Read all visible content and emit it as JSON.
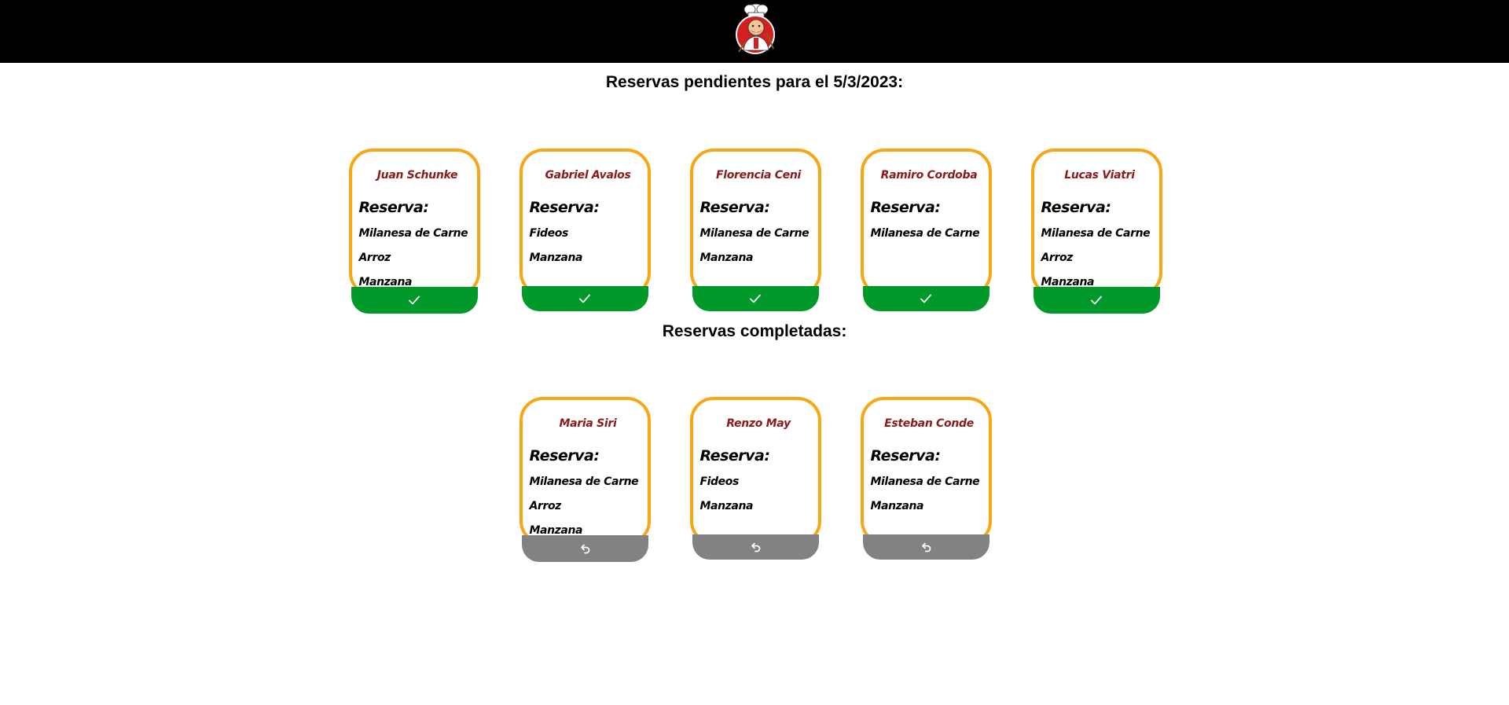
{
  "header": {
    "logo_icon": "chef-logo"
  },
  "pending": {
    "title": "Reservas pendientes para el 5/3/2023:",
    "button_icon": "check-icon",
    "cards": [
      {
        "name": "Juan Schunke",
        "heading": "Reserva:",
        "items": [
          "Milanesa de Carne",
          "Arroz",
          "Manzana"
        ]
      },
      {
        "name": "Gabriel Avalos",
        "heading": "Reserva:",
        "items": [
          "Fideos",
          "Manzana"
        ]
      },
      {
        "name": "Florencia Ceni",
        "heading": "Reserva:",
        "items": [
          "Milanesa de Carne",
          "Manzana"
        ]
      },
      {
        "name": "Ramiro Cordoba",
        "heading": "Reserva:",
        "items": [
          "Milanesa de Carne"
        ]
      },
      {
        "name": "Lucas Viatri",
        "heading": "Reserva:",
        "items": [
          "Milanesa de Carne",
          "Arroz",
          "Manzana"
        ]
      }
    ]
  },
  "completed": {
    "title": "Reservas completadas:",
    "button_icon": "undo-icon",
    "cards": [
      {
        "name": "Maria Siri",
        "heading": "Reserva:",
        "items": [
          "Milanesa de Carne",
          "Arroz",
          "Manzana"
        ]
      },
      {
        "name": "Renzo May",
        "heading": "Reserva:",
        "items": [
          "Fideos",
          "Manzana"
        ]
      },
      {
        "name": "Esteban Conde",
        "heading": "Reserva:",
        "items": [
          "Milanesa de Carne",
          "Manzana"
        ]
      }
    ]
  },
  "colors": {
    "card_border": "#f7a614",
    "name_text": "#8c1a1a",
    "complete_button": "#00992a",
    "undo_button": "#828282",
    "header_bg": "#000000"
  }
}
